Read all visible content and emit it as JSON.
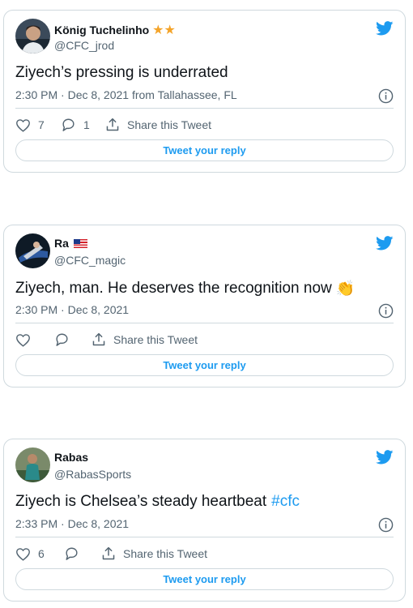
{
  "tweets": [
    {
      "name": "König Tuchelinho",
      "badge": "★★",
      "handle": "@CFC_jrod",
      "text": "Ziyech’s pressing is underrated",
      "timestamp": "2:30 PM · Dec 8, 2021 from Tallahassee, FL",
      "likes": "7",
      "replies": "1",
      "share_label": "Share this Tweet",
      "reply_label": "Tweet your reply"
    },
    {
      "name": "Ra",
      "badge": "🇲🇾",
      "handle": "@CFC_magic",
      "text": "Ziyech, man. He deserves the recognition now",
      "emoji": "👏",
      "timestamp": "2:30 PM · Dec 8, 2021",
      "likes": "",
      "replies": "",
      "share_label": "Share this Tweet",
      "reply_label": "Tweet your reply"
    },
    {
      "name": "Rabas",
      "handle": "@RabasSports",
      "text": "Ziyech is Chelsea’s steady heartbeat",
      "hashtag": "#cfc",
      "timestamp": "2:33 PM · Dec 8, 2021",
      "likes": "6",
      "replies": "",
      "share_label": "Share this Tweet",
      "reply_label": "Tweet your reply"
    }
  ],
  "colors": {
    "accent": "#1d9bf0",
    "text": "#0f1419",
    "muted": "#536471",
    "border": "#cfd9de",
    "star": "#f4a42a"
  },
  "icons": [
    "twitter-bird-icon",
    "info-icon",
    "heart-icon",
    "reply-icon",
    "share-icon"
  ]
}
